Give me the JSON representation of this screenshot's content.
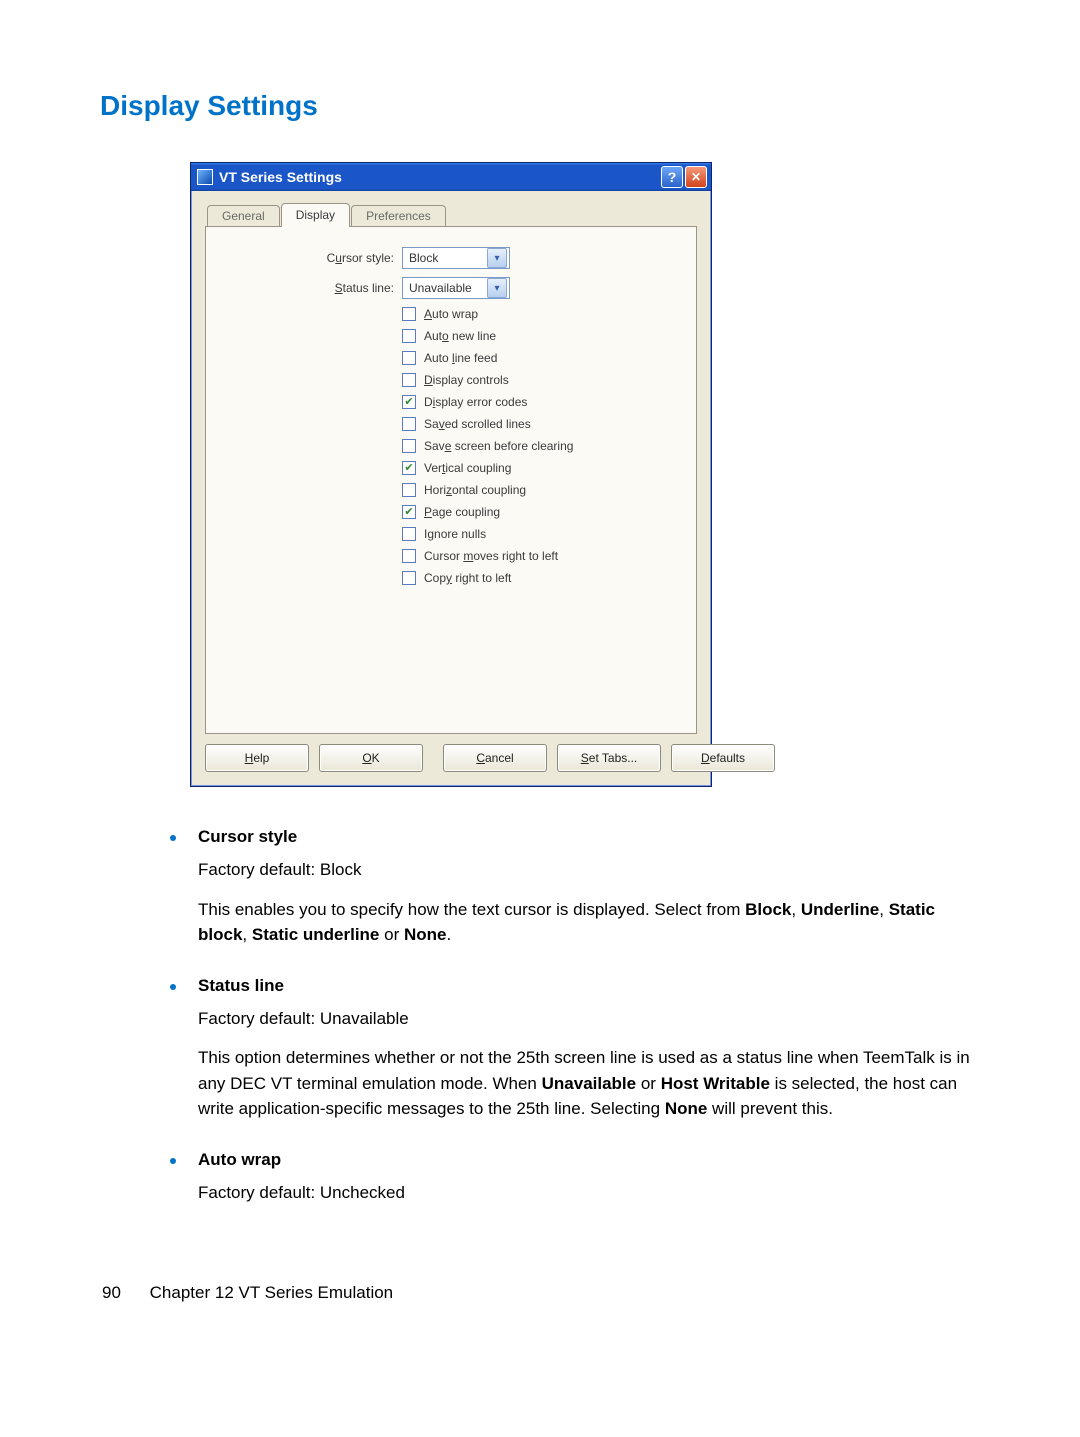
{
  "heading": "Display Settings",
  "dialog": {
    "title": "VT Series Settings",
    "tabs": {
      "general": "General",
      "display": "Display",
      "preferences": "Preferences"
    },
    "labels": {
      "cursor_style": "Cursor style:",
      "status_line": "Status line:"
    },
    "selects": {
      "cursor_style_value": "Block",
      "status_line_value": "Unavailable"
    },
    "checkboxes": {
      "auto_wrap": "Auto wrap",
      "auto_new_line": "Auto new line",
      "auto_line_feed": "Auto line feed",
      "display_controls": "Display controls",
      "display_error_codes": "Display error codes",
      "saved_scrolled_lines": "Saved scrolled lines",
      "save_screen_before_clearing": "Save screen before clearing",
      "vertical_coupling": "Vertical coupling",
      "horizontal_coupling": "Horizontal coupling",
      "page_coupling": "Page coupling",
      "ignore_nulls": "Ignore nulls",
      "cursor_moves_rtl": "Cursor moves right to left",
      "copy_rtl": "Copy right to left"
    },
    "buttons": {
      "help": "Help",
      "ok": "OK",
      "cancel": "Cancel",
      "set_tabs": "Set Tabs...",
      "defaults": "Defaults"
    }
  },
  "doc": {
    "items": {
      "cursor_style": {
        "title": "Cursor style",
        "default": "Factory default: Block",
        "body_pre": "This enables you to specify how the text cursor is displayed. Select from ",
        "b1": "Block",
        "sep1": ", ",
        "b2": "Underline",
        "sep2": ", ",
        "b3": "Static block",
        "sep3": ", ",
        "b4": "Static underline",
        "sep4": " or ",
        "b5": "None",
        "tail": "."
      },
      "status_line": {
        "title": "Status line",
        "default": "Factory default: Unavailable",
        "p_pre": "This option determines whether or not the 25th screen line is used as a status line when TeemTalk is in any DEC VT terminal emulation mode. When ",
        "b1": "Unavailable",
        "mid1": " or ",
        "b2": "Host Writable",
        "mid2": " is selected, the host can write application-specific messages to the 25th line. Selecting ",
        "b3": "None",
        "tail": " will prevent this."
      },
      "auto_wrap": {
        "title": "Auto wrap",
        "default": "Factory default: Unchecked"
      }
    }
  },
  "footer": {
    "page": "90",
    "chapter": "Chapter 12   VT Series Emulation"
  }
}
